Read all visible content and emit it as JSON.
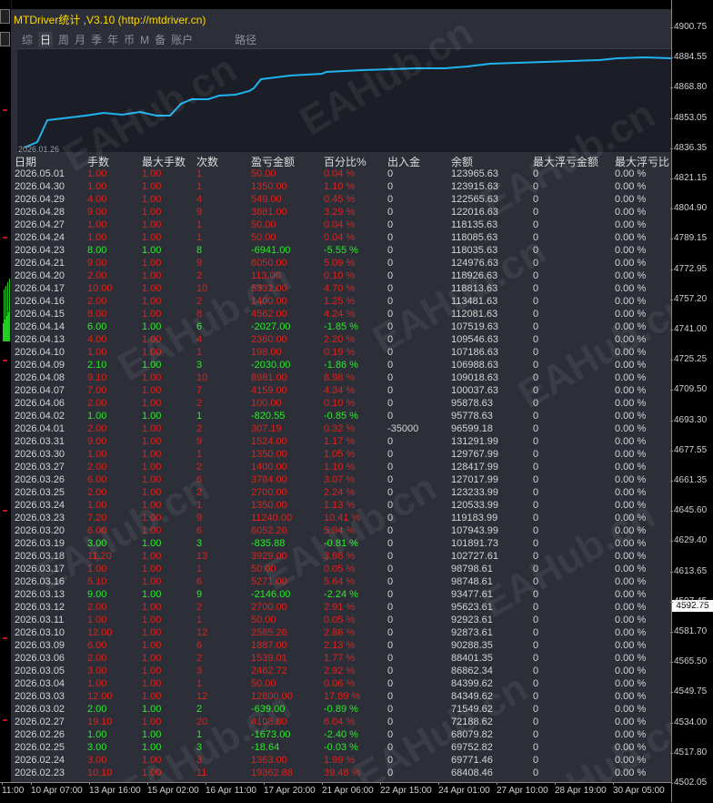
{
  "panel": {
    "title": "MTDriver统计 ,V3.10 (http://mtdriver.cn)",
    "tabs": [
      "综",
      "日",
      "周",
      "月",
      "季",
      "年",
      "币",
      "M",
      "备",
      "账户"
    ],
    "path_tab": "路径",
    "active_tab": "日",
    "curve_start_date": "2026.01.26",
    "curve_color": "#1fb4f0"
  },
  "table": {
    "headers": [
      "日期",
      "手数",
      "最大手数",
      "次数",
      "盈亏金额",
      "百分比%",
      "出入金",
      "余额",
      "最大浮亏金额",
      "最大浮亏比"
    ],
    "rows": [
      {
        "date": "2026.05.01",
        "lots": "1.00",
        "max_lots": "1.00",
        "count": "1",
        "pnl": "50.00",
        "pct": "0.04 %",
        "flow": "0",
        "balance": "123965.63",
        "max_dd": "0",
        "max_dd_pct": "0.00 %",
        "color": "red"
      },
      {
        "date": "2026.04.30",
        "lots": "1.00",
        "max_lots": "1.00",
        "count": "1",
        "pnl": "1350.00",
        "pct": "1.10 %",
        "flow": "0",
        "balance": "123915.63",
        "max_dd": "0",
        "max_dd_pct": "0.00 %",
        "color": "red"
      },
      {
        "date": "2026.04.29",
        "lots": "4.00",
        "max_lots": "1.00",
        "count": "4",
        "pnl": "549.00",
        "pct": "0.45 %",
        "flow": "0",
        "balance": "122565.63",
        "max_dd": "0",
        "max_dd_pct": "0.00 %",
        "color": "red"
      },
      {
        "date": "2026.04.28",
        "lots": "9.00",
        "max_lots": "1.00",
        "count": "9",
        "pnl": "3881.00",
        "pct": "3.29 %",
        "flow": "0",
        "balance": "122016.63",
        "max_dd": "0",
        "max_dd_pct": "0.00 %",
        "color": "red"
      },
      {
        "date": "2026.04.27",
        "lots": "1.00",
        "max_lots": "1.00",
        "count": "1",
        "pnl": "50.00",
        "pct": "0.04 %",
        "flow": "0",
        "balance": "118135.63",
        "max_dd": "0",
        "max_dd_pct": "0.00 %",
        "color": "red"
      },
      {
        "date": "2026.04.24",
        "lots": "1.00",
        "max_lots": "1.00",
        "count": "1",
        "pnl": "50.00",
        "pct": "0.04 %",
        "flow": "0",
        "balance": "118085.63",
        "max_dd": "0",
        "max_dd_pct": "0.00 %",
        "color": "red"
      },
      {
        "date": "2026.04.23",
        "lots": "8.00",
        "max_lots": "1.00",
        "count": "8",
        "pnl": "-6941.00",
        "pct": "-5.55 %",
        "flow": "0",
        "balance": "118035.63",
        "max_dd": "0",
        "max_dd_pct": "0.00 %",
        "color": "green"
      },
      {
        "date": "2026.04.21",
        "lots": "9.00",
        "max_lots": "1.00",
        "count": "9",
        "pnl": "6050.00",
        "pct": "5.09 %",
        "flow": "0",
        "balance": "124976.63",
        "max_dd": "0",
        "max_dd_pct": "0.00 %",
        "color": "red"
      },
      {
        "date": "2026.04.20",
        "lots": "2.00",
        "max_lots": "1.00",
        "count": "2",
        "pnl": "113.00",
        "pct": "0.10 %",
        "flow": "0",
        "balance": "118926.63",
        "max_dd": "0",
        "max_dd_pct": "0.00 %",
        "color": "red"
      },
      {
        "date": "2026.04.17",
        "lots": "10.00",
        "max_lots": "1.00",
        "count": "10",
        "pnl": "5332.00",
        "pct": "4.70 %",
        "flow": "0",
        "balance": "118813.63",
        "max_dd": "0",
        "max_dd_pct": "0.00 %",
        "color": "red"
      },
      {
        "date": "2026.04.16",
        "lots": "2.00",
        "max_lots": "1.00",
        "count": "2",
        "pnl": "1400.00",
        "pct": "1.25 %",
        "flow": "0",
        "balance": "113481.63",
        "max_dd": "0",
        "max_dd_pct": "0.00 %",
        "color": "red"
      },
      {
        "date": "2026.04.15",
        "lots": "8.00",
        "max_lots": "1.00",
        "count": "8",
        "pnl": "4562.00",
        "pct": "4.24 %",
        "flow": "0",
        "balance": "112081.63",
        "max_dd": "0",
        "max_dd_pct": "0.00 %",
        "color": "red"
      },
      {
        "date": "2026.04.14",
        "lots": "6.00",
        "max_lots": "1.00",
        "count": "6",
        "pnl": "-2027.00",
        "pct": "-1.85 %",
        "flow": "0",
        "balance": "107519.63",
        "max_dd": "0",
        "max_dd_pct": "0.00 %",
        "color": "green"
      },
      {
        "date": "2026.04.13",
        "lots": "4.00",
        "max_lots": "1.00",
        "count": "4",
        "pnl": "2360.00",
        "pct": "2.20 %",
        "flow": "0",
        "balance": "109546.63",
        "max_dd": "0",
        "max_dd_pct": "0.00 %",
        "color": "red"
      },
      {
        "date": "2026.04.10",
        "lots": "1.00",
        "max_lots": "1.00",
        "count": "1",
        "pnl": "198.00",
        "pct": "0.19 %",
        "flow": "0",
        "balance": "107186.63",
        "max_dd": "0",
        "max_dd_pct": "0.00 %",
        "color": "red"
      },
      {
        "date": "2026.04.09",
        "lots": "2.10",
        "max_lots": "1.00",
        "count": "3",
        "pnl": "-2030.00",
        "pct": "-1.86 %",
        "flow": "0",
        "balance": "106988.63",
        "max_dd": "0",
        "max_dd_pct": "0.00 %",
        "color": "green"
      },
      {
        "date": "2026.04.08",
        "lots": "9.10",
        "max_lots": "1.00",
        "count": "10",
        "pnl": "8981.00",
        "pct": "8.98 %",
        "flow": "0",
        "balance": "109018.63",
        "max_dd": "0",
        "max_dd_pct": "0.00 %",
        "color": "red"
      },
      {
        "date": "2026.04.07",
        "lots": "7.00",
        "max_lots": "1.00",
        "count": "7",
        "pnl": "4159.00",
        "pct": "4.34 %",
        "flow": "0",
        "balance": "100037.63",
        "max_dd": "0",
        "max_dd_pct": "0.00 %",
        "color": "red"
      },
      {
        "date": "2026.04.06",
        "lots": "2.00",
        "max_lots": "1.00",
        "count": "2",
        "pnl": "100.00",
        "pct": "0.10 %",
        "flow": "0",
        "balance": "95878.63",
        "max_dd": "0",
        "max_dd_pct": "0.00 %",
        "color": "red"
      },
      {
        "date": "2026.04.02",
        "lots": "1.00",
        "max_lots": "1.00",
        "count": "1",
        "pnl": "-820.55",
        "pct": "-0.85 %",
        "flow": "0",
        "balance": "95778.63",
        "max_dd": "0",
        "max_dd_pct": "0.00 %",
        "color": "green"
      },
      {
        "date": "2026.04.01",
        "lots": "2.00",
        "max_lots": "1.00",
        "count": "2",
        "pnl": "307.19",
        "pct": "0.32 %",
        "flow": "-35000",
        "balance": "96599.18",
        "max_dd": "0",
        "max_dd_pct": "0.00 %",
        "color": "red",
        "flow_color": "green"
      },
      {
        "date": "2026.03.31",
        "lots": "9.00",
        "max_lots": "1.00",
        "count": "9",
        "pnl": "1524.00",
        "pct": "1.17 %",
        "flow": "0",
        "balance": "131291.99",
        "max_dd": "0",
        "max_dd_pct": "0.00 %",
        "color": "red"
      },
      {
        "date": "2026.03.30",
        "lots": "1.00",
        "max_lots": "1.00",
        "count": "1",
        "pnl": "1350.00",
        "pct": "1.05 %",
        "flow": "0",
        "balance": "129767.99",
        "max_dd": "0",
        "max_dd_pct": "0.00 %",
        "color": "red"
      },
      {
        "date": "2026.03.27",
        "lots": "2.00",
        "max_lots": "1.00",
        "count": "2",
        "pnl": "1400.00",
        "pct": "1.10 %",
        "flow": "0",
        "balance": "128417.99",
        "max_dd": "0",
        "max_dd_pct": "0.00 %",
        "color": "red"
      },
      {
        "date": "2026.03.26",
        "lots": "6.00",
        "max_lots": "1.00",
        "count": "6",
        "pnl": "3784.00",
        "pct": "3.07 %",
        "flow": "0",
        "balance": "127017.99",
        "max_dd": "0",
        "max_dd_pct": "0.00 %",
        "color": "red"
      },
      {
        "date": "2026.03.25",
        "lots": "2.00",
        "max_lots": "1.00",
        "count": "2",
        "pnl": "2700.00",
        "pct": "2.24 %",
        "flow": "0",
        "balance": "123233.99",
        "max_dd": "0",
        "max_dd_pct": "0.00 %",
        "color": "red"
      },
      {
        "date": "2026.03.24",
        "lots": "1.00",
        "max_lots": "1.00",
        "count": "1",
        "pnl": "1350.00",
        "pct": "1.13 %",
        "flow": "0",
        "balance": "120533.99",
        "max_dd": "0",
        "max_dd_pct": "0.00 %",
        "color": "red"
      },
      {
        "date": "2026.03.23",
        "lots": "7.20",
        "max_lots": "1.00",
        "count": "9",
        "pnl": "11240.00",
        "pct": "10.41 %",
        "flow": "0",
        "balance": "119183.99",
        "max_dd": "0",
        "max_dd_pct": "0.00 %",
        "color": "red"
      },
      {
        "date": "2026.03.20",
        "lots": "6.00",
        "max_lots": "1.00",
        "count": "6",
        "pnl": "6052.26",
        "pct": "5.94 %",
        "flow": "0",
        "balance": "107943.99",
        "max_dd": "0",
        "max_dd_pct": "0.00 %",
        "color": "red"
      },
      {
        "date": "2026.03.19",
        "lots": "3.00",
        "max_lots": "1.00",
        "count": "3",
        "pnl": "-835.88",
        "pct": "-0.81 %",
        "flow": "0",
        "balance": "101891.73",
        "max_dd": "0",
        "max_dd_pct": "0.00 %",
        "color": "green"
      },
      {
        "date": "2026.03.18",
        "lots": "11.20",
        "max_lots": "1.00",
        "count": "13",
        "pnl": "3929.00",
        "pct": "3.98 %",
        "flow": "0",
        "balance": "102727.61",
        "max_dd": "0",
        "max_dd_pct": "0.00 %",
        "color": "red"
      },
      {
        "date": "2026.03.17",
        "lots": "1.00",
        "max_lots": "1.00",
        "count": "1",
        "pnl": "50.00",
        "pct": "0.05 %",
        "flow": "0",
        "balance": "98798.61",
        "max_dd": "0",
        "max_dd_pct": "0.00 %",
        "color": "red"
      },
      {
        "date": "2026.03.16",
        "lots": "5.10",
        "max_lots": "1.00",
        "count": "6",
        "pnl": "5271.00",
        "pct": "5.64 %",
        "flow": "0",
        "balance": "98748.61",
        "max_dd": "0",
        "max_dd_pct": "0.00 %",
        "color": "red"
      },
      {
        "date": "2026.03.13",
        "lots": "9.00",
        "max_lots": "1.00",
        "count": "9",
        "pnl": "-2146.00",
        "pct": "-2.24 %",
        "flow": "0",
        "balance": "93477.61",
        "max_dd": "0",
        "max_dd_pct": "0.00 %",
        "color": "green"
      },
      {
        "date": "2026.03.12",
        "lots": "2.00",
        "max_lots": "1.00",
        "count": "2",
        "pnl": "2700.00",
        "pct": "2.91 %",
        "flow": "0",
        "balance": "95623.61",
        "max_dd": "0",
        "max_dd_pct": "0.00 %",
        "color": "red"
      },
      {
        "date": "2026.03.11",
        "lots": "1.00",
        "max_lots": "1.00",
        "count": "1",
        "pnl": "50.00",
        "pct": "0.05 %",
        "flow": "0",
        "balance": "92923.61",
        "max_dd": "0",
        "max_dd_pct": "0.00 %",
        "color": "red"
      },
      {
        "date": "2026.03.10",
        "lots": "12.00",
        "max_lots": "1.00",
        "count": "12",
        "pnl": "2585.26",
        "pct": "2.86 %",
        "flow": "0",
        "balance": "92873.61",
        "max_dd": "0",
        "max_dd_pct": "0.00 %",
        "color": "red"
      },
      {
        "date": "2026.03.09",
        "lots": "6.00",
        "max_lots": "1.00",
        "count": "6",
        "pnl": "1887.00",
        "pct": "2.13 %",
        "flow": "0",
        "balance": "90288.35",
        "max_dd": "0",
        "max_dd_pct": "0.00 %",
        "color": "red"
      },
      {
        "date": "2026.03.06",
        "lots": "2.00",
        "max_lots": "1.00",
        "count": "2",
        "pnl": "1539.01",
        "pct": "1.77 %",
        "flow": "0",
        "balance": "88401.35",
        "max_dd": "0",
        "max_dd_pct": "0.00 %",
        "color": "red"
      },
      {
        "date": "2026.03.05",
        "lots": "3.00",
        "max_lots": "1.00",
        "count": "3",
        "pnl": "2462.72",
        "pct": "2.92 %",
        "flow": "0",
        "balance": "86862.34",
        "max_dd": "0",
        "max_dd_pct": "0.00 %",
        "color": "red"
      },
      {
        "date": "2026.03.04",
        "lots": "1.00",
        "max_lots": "1.00",
        "count": "1",
        "pnl": "50.00",
        "pct": "0.06 %",
        "flow": "0",
        "balance": "84399.62",
        "max_dd": "0",
        "max_dd_pct": "0.00 %",
        "color": "red"
      },
      {
        "date": "2026.03.03",
        "lots": "12.00",
        "max_lots": "1.00",
        "count": "12",
        "pnl": "12800.00",
        "pct": "17.89 %",
        "flow": "0",
        "balance": "84349.62",
        "max_dd": "0",
        "max_dd_pct": "0.00 %",
        "color": "red"
      },
      {
        "date": "2026.03.02",
        "lots": "2.00",
        "max_lots": "1.00",
        "count": "2",
        "pnl": "-639.00",
        "pct": "-0.89 %",
        "flow": "0",
        "balance": "71549.62",
        "max_dd": "0",
        "max_dd_pct": "0.00 %",
        "color": "green"
      },
      {
        "date": "2026.02.27",
        "lots": "19.10",
        "max_lots": "1.00",
        "count": "20",
        "pnl": "4108.80",
        "pct": "6.04 %",
        "flow": "0",
        "balance": "72188.62",
        "max_dd": "0",
        "max_dd_pct": "0.00 %",
        "color": "red"
      },
      {
        "date": "2026.02.26",
        "lots": "1.00",
        "max_lots": "1.00",
        "count": "1",
        "pnl": "-1673.00",
        "pct": "-2.40 %",
        "flow": "0",
        "balance": "68079.82",
        "max_dd": "0",
        "max_dd_pct": "0.00 %",
        "color": "green"
      },
      {
        "date": "2026.02.25",
        "lots": "3.00",
        "max_lots": "1.00",
        "count": "3",
        "pnl": "-18.64",
        "pct": "-0.03 %",
        "flow": "0",
        "balance": "69752.82",
        "max_dd": "0",
        "max_dd_pct": "0.00 %",
        "color": "green"
      },
      {
        "date": "2026.02.24",
        "lots": "3.00",
        "max_lots": "1.00",
        "count": "3",
        "pnl": "1363.00",
        "pct": "1.99 %",
        "flow": "0",
        "balance": "69771.46",
        "max_dd": "0",
        "max_dd_pct": "0.00 %",
        "color": "red"
      },
      {
        "date": "2026.02.23",
        "lots": "10.10",
        "max_lots": "1.00",
        "count": "11",
        "pnl": "19362.88",
        "pct": "39.48 %",
        "flow": "0",
        "balance": "68408.46",
        "max_dd": "0",
        "max_dd_pct": "0.00 %",
        "color": "red"
      }
    ]
  },
  "price_axis": {
    "ticks": [
      "4900.75",
      "4884.55",
      "4868.80",
      "4853.05",
      "4836.35",
      "4821.15",
      "4804.90",
      "4789.15",
      "4772.95",
      "4757.20",
      "4741.00",
      "4725.25",
      "4709.50",
      "4693.30",
      "4677.55",
      "4661.35",
      "4645.60",
      "4629.40",
      "4613.65",
      "4597.45",
      "4581.70",
      "4565.50",
      "4549.75",
      "4534.00",
      "4517.80",
      "4502.05"
    ],
    "current": "4592.75"
  },
  "time_axis": {
    "ticks": [
      "11:00",
      "10 Apr 07:00",
      "13 Apr 16:00",
      "15 Apr 02:00",
      "16 Apr 11:00",
      "17 Apr 20:00",
      "21 Apr 06:00",
      "22 Apr 15:00",
      "24 Apr 01:00",
      "27 Apr 10:00",
      "28 Apr 19:00",
      "30 Apr 05:00"
    ]
  },
  "watermark": "EAHub.cn",
  "colors": {
    "positive": "#e0201a",
    "negative": "#2ee82e",
    "title": "#ffd800",
    "panel_bg": "#2c2f37"
  }
}
